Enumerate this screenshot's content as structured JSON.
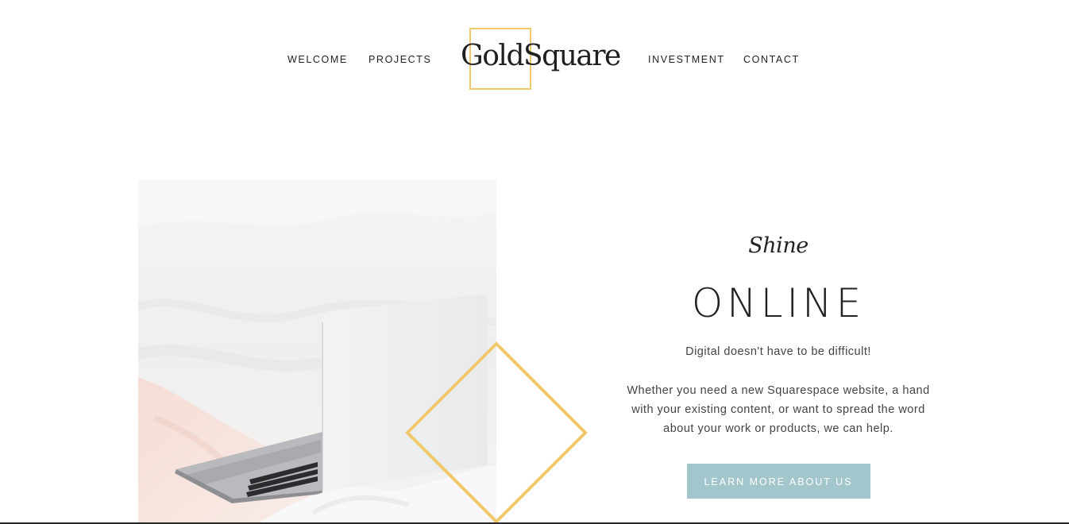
{
  "nav": {
    "left": [
      {
        "label": "WELCOME"
      },
      {
        "label": "PROJECTS"
      }
    ],
    "right": [
      {
        "label": "INVESTMENT"
      },
      {
        "label": "CONTACT"
      }
    ]
  },
  "logo": {
    "text": "GoldSquare"
  },
  "hero": {
    "image_alt": "laptop-on-bed-photo"
  },
  "content": {
    "script_word": "Shine",
    "headline": "ONLINE",
    "tagline": "Digital doesn't have to be difficult!",
    "description": "Whether you need a new Squarespace website, a hand with your existing content, or want to spread the word about your work or products, we can help.",
    "cta_label": "LEARN MORE ABOUT US"
  },
  "colors": {
    "accent_gold": "#efc96b",
    "button_teal": "#a2c6cc",
    "text_dark": "#222222"
  }
}
